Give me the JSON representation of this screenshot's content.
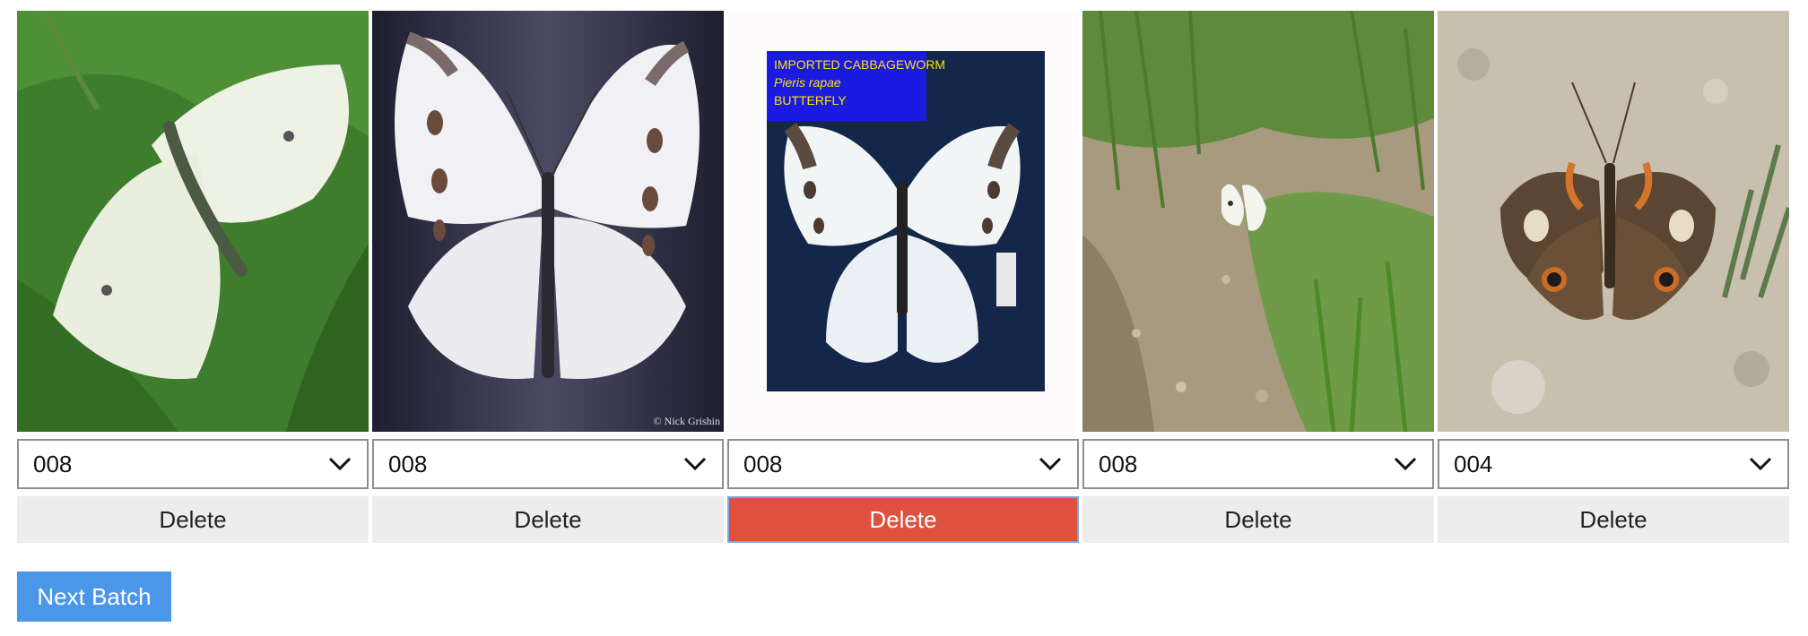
{
  "cards": [
    {
      "image_name": "white-butterfly-on-leaf-photo",
      "selected_value": "008",
      "delete_label": "Delete",
      "delete_active": false
    },
    {
      "image_name": "white-butterfly-dark-background-photo",
      "selected_value": "008",
      "delete_label": "Delete",
      "delete_active": false,
      "photo_credit": "© Nick Grishin"
    },
    {
      "image_name": "imported-cabbageworm-specimen-photo",
      "selected_value": "008",
      "delete_label": "Delete",
      "delete_active": true,
      "specimen_label": {
        "line1": "IMPORTED CABBAGEWORM",
        "line2": "Pieris rapae",
        "line3": "BUTTERFLY"
      }
    },
    {
      "image_name": "white-butterfly-in-grass-photo",
      "selected_value": "008",
      "delete_label": "Delete",
      "delete_active": false
    },
    {
      "image_name": "buckeye-butterfly-on-ground-photo",
      "selected_value": "004",
      "delete_label": "Delete",
      "delete_active": false
    }
  ],
  "next_batch_label": "Next Batch",
  "colors": {
    "delete_default_bg": "#ededed",
    "delete_active_bg": "#e0503f",
    "next_button_bg": "#4a96e8"
  },
  "icons": {
    "dropdown": "chevron-down-icon"
  }
}
